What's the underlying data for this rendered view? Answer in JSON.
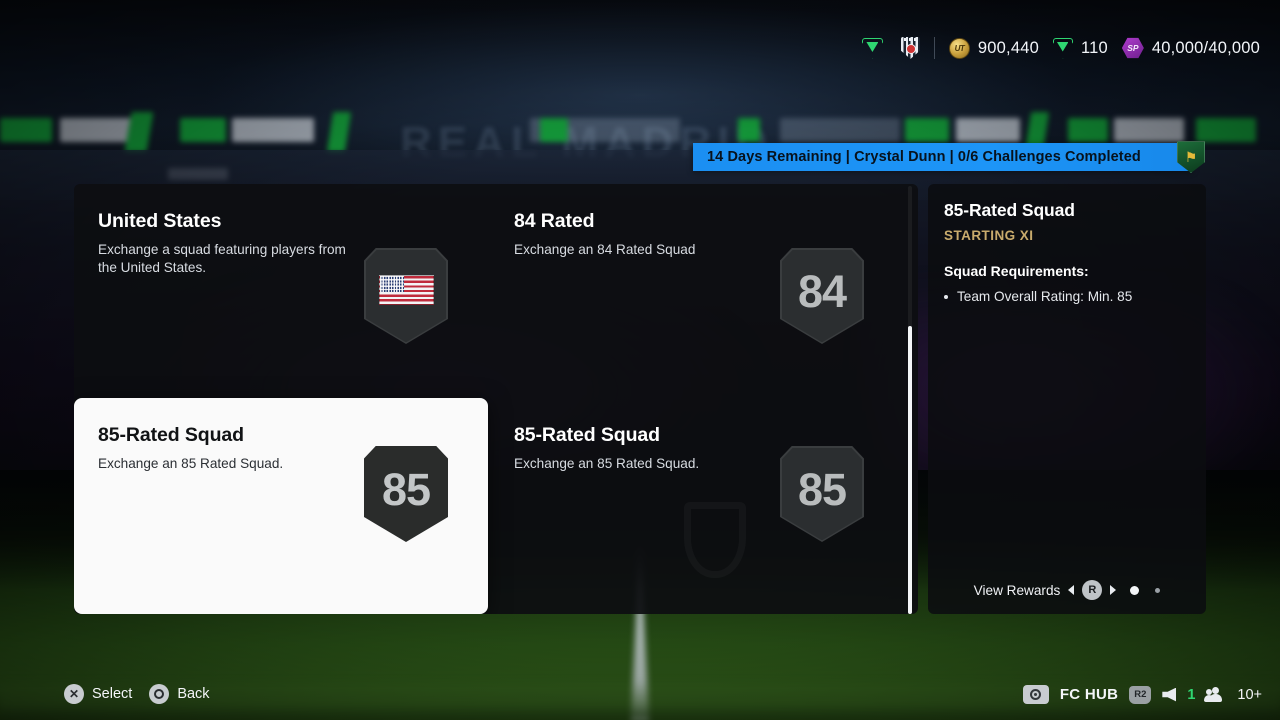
{
  "hud": {
    "icons": [
      {
        "name": "fc-logo-icon",
        "label": "FC"
      },
      {
        "name": "club-crest-icon",
        "label": ""
      }
    ],
    "currencies": [
      {
        "icon": "ut-coin-icon",
        "icon_label": "UT",
        "value": "900,440"
      },
      {
        "icon": "fc-points-icon",
        "icon_label": "FC",
        "value": "110"
      },
      {
        "icon": "sp-icon",
        "icon_label": "SP",
        "value": "40,000/40,000"
      }
    ]
  },
  "ribbon": {
    "text": "14 Days Remaining | Crystal Dunn | 0/6 Challenges Completed",
    "crest_glyph": "⚑",
    "color": "#1b8ff2"
  },
  "cards": [
    {
      "title": "United States",
      "desc": "Exchange a squad featuring players from the United States.",
      "badge_type": "flag",
      "badge_value": "",
      "selected": false
    },
    {
      "title": "84 Rated",
      "desc": "Exchange an 84 Rated Squad",
      "badge_type": "rating",
      "badge_value": "84",
      "selected": false
    },
    {
      "title": "85-Rated Squad",
      "desc": "Exchange an 85 Rated Squad.",
      "badge_type": "rating",
      "badge_value": "85",
      "selected": true
    },
    {
      "title": "85-Rated Squad",
      "desc": "Exchange an 85 Rated Squad.",
      "badge_type": "rating",
      "badge_value": "85",
      "selected": false
    }
  ],
  "side_panel": {
    "title": "85-Rated Squad",
    "subtitle": "STARTING XI",
    "subtitle_color": "#c9ab6d",
    "requirements_heading": "Squad Requirements:",
    "requirements": [
      "Team Overall Rating: Min. 85"
    ],
    "rewards_label": "View Rewards",
    "rewards_button": "R",
    "page_dots": 2,
    "active_dot": 0
  },
  "bottom_bar": {
    "left": [
      {
        "button": "X",
        "label": "Select"
      },
      {
        "button": "O",
        "label": "Back"
      }
    ],
    "right": {
      "hub_label": "FC HUB",
      "r2_label": "R2",
      "voice_count": "1",
      "people_count": "10+"
    }
  },
  "background": {
    "stadium_text": "REAL MADRID"
  }
}
